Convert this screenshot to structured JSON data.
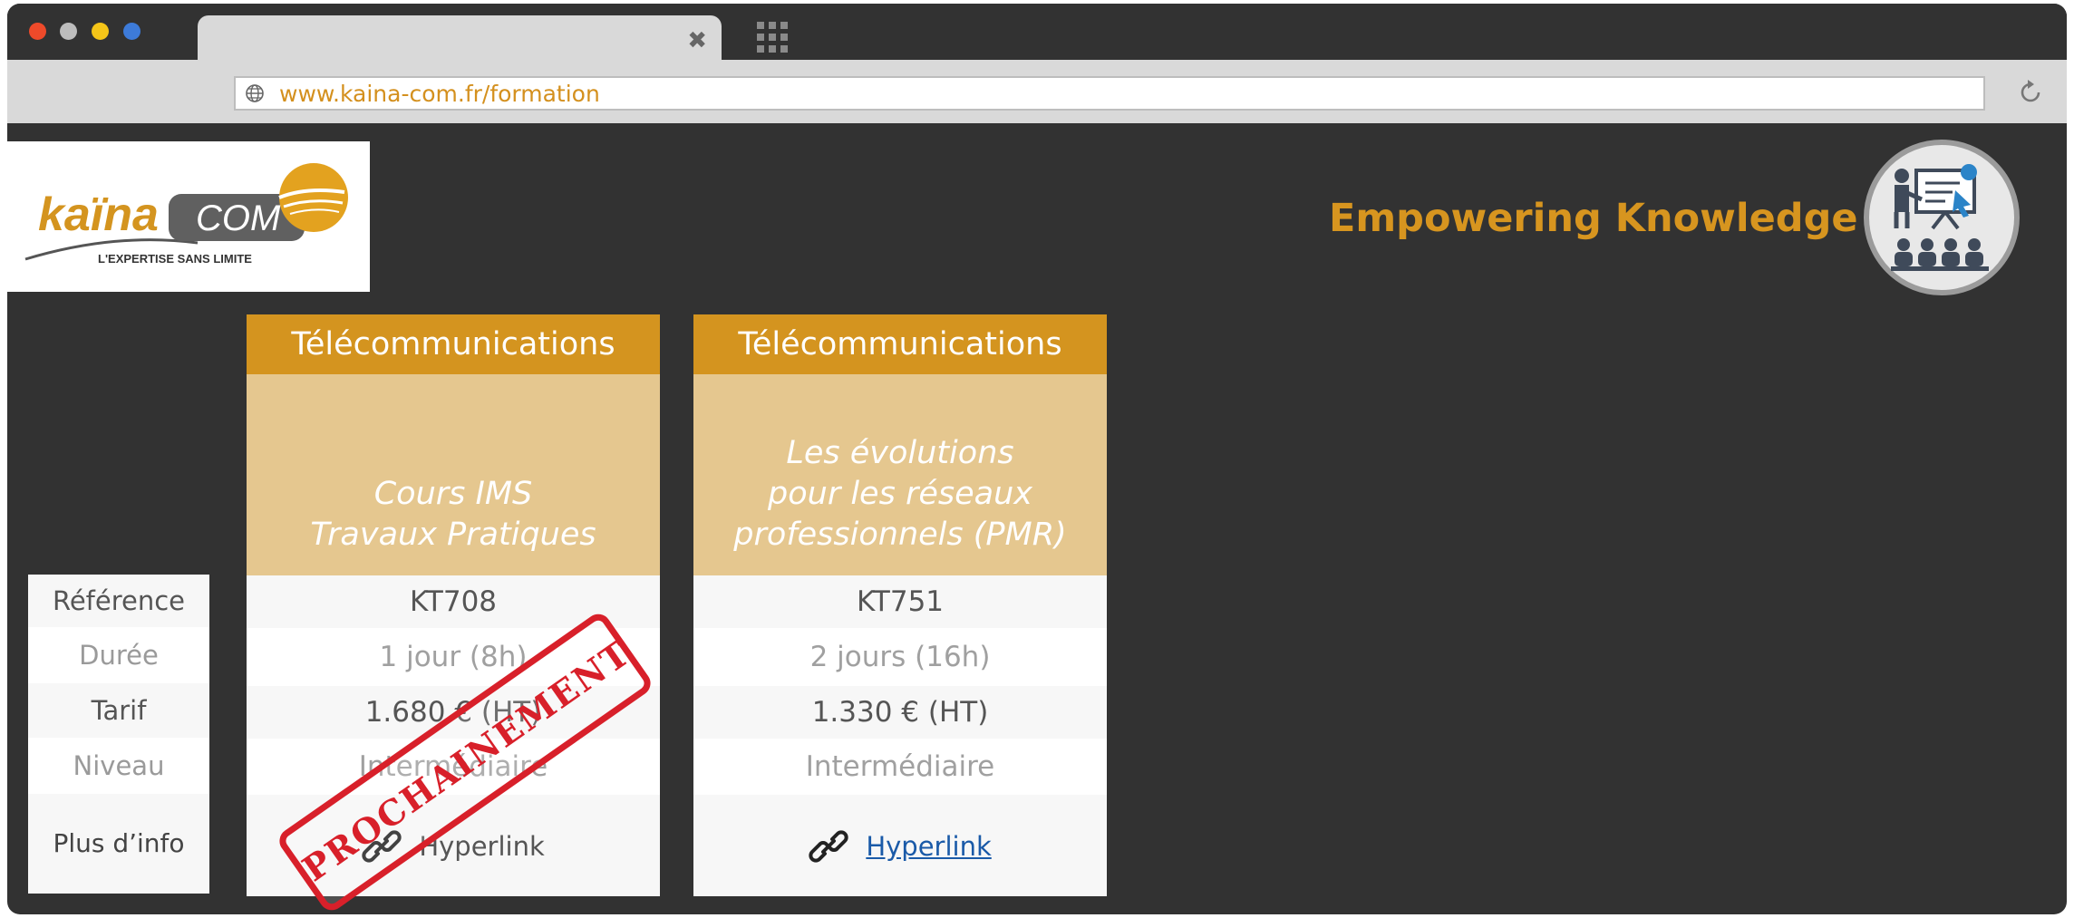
{
  "browser": {
    "url": "www.kaina-com.fr/formation",
    "window_dots": [
      "#ee4a2a",
      "#bdbdbd",
      "#f5c518",
      "#3d7bd9"
    ]
  },
  "header": {
    "logo_word": "kaïna",
    "logo_suffix": "COM",
    "logo_tagline": "L'EXPERTISE SANS LIMITE",
    "tagline": "Empowering Knowledge"
  },
  "labels": [
    "Référence",
    "Durée",
    "Tarif",
    "Niveau",
    "Plus d’info"
  ],
  "cards": [
    {
      "category": "Télécommunications",
      "title": "Cours IMS\nTravaux Pratiques",
      "reference": "KT708",
      "duration": "1 jour (8h)",
      "price": "1.680 € (HT)",
      "level": "Intermédiaire",
      "link": "Hyperlink",
      "stamp": "PROCHAINEMENT"
    },
    {
      "category": "Télécommunications",
      "title": "Les évolutions\npour les réseaux\nprofessionnels (PMR)",
      "reference": "KT751",
      "duration": "2 jours (16h)",
      "price": "1.330 € (HT)",
      "level": "Intermédiaire",
      "link": "Hyperlink"
    }
  ],
  "colors": {
    "accent": "#d4941f",
    "title_band": "#e5c78f",
    "stamp": "#d8202a",
    "link": "#1a5aa8",
    "background": "#323232"
  }
}
